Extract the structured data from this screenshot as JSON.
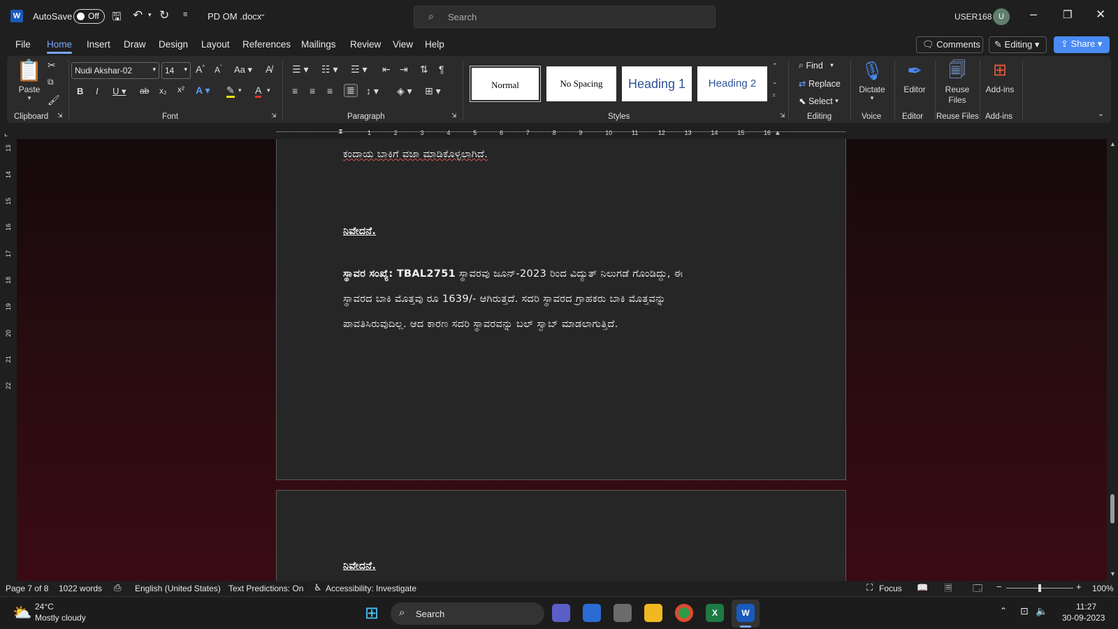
{
  "titlebar": {
    "app_icon": "W",
    "autosave_label": "AutoSave",
    "autosave_state": "Off",
    "doc_title": "PD OM .docx",
    "search_placeholder": "Search",
    "user": "USER168",
    "avatar_initial": "U"
  },
  "menu": {
    "tabs": [
      "File",
      "Home",
      "Insert",
      "Draw",
      "Design",
      "Layout",
      "References",
      "Mailings",
      "Review",
      "View",
      "Help"
    ],
    "active": "Home",
    "comments": "Comments",
    "editing": "Editing",
    "share": "Share"
  },
  "ribbon": {
    "clipboard": {
      "paste": "Paste",
      "label": "Clipboard"
    },
    "font": {
      "name": "Nudi Akshar-02",
      "size": "14",
      "label": "Font"
    },
    "paragraph": {
      "label": "Paragraph"
    },
    "styles": {
      "items": [
        "Normal",
        "No Spacing",
        "Heading 1",
        "Heading 2"
      ],
      "label": "Styles"
    },
    "editing": {
      "find": "Find",
      "replace": "Replace",
      "select": "Select",
      "label": "Editing"
    },
    "voice": {
      "dictate": "Dictate",
      "label": "Voice"
    },
    "editor": {
      "button": "Editor",
      "label": "Editor"
    },
    "reuse": {
      "button_line1": "Reuse",
      "button_line2": "Files",
      "label": "Reuse Files"
    },
    "addins": {
      "button": "Add-ins",
      "label": "Add-ins"
    }
  },
  "ruler": {
    "h_ticks": [
      "1",
      "2",
      "3",
      "4",
      "5",
      "6",
      "7",
      "8",
      "9",
      "10",
      "11",
      "12",
      "13",
      "14",
      "15",
      "16"
    ],
    "v_ticks": [
      "13",
      "14",
      "15",
      "16",
      "17",
      "18",
      "19",
      "20",
      "21",
      "22"
    ]
  },
  "document": {
    "line_top": "ಕಂದಾಯ ಬಾಕಿಗೆ ವಜಾ ಮಾಡಿಕೊಳ್ಳಲಾಗಿದೆ.",
    "heading1": "ನಿವೇದನೆ.",
    "para_label": "ಸ್ಥಾವರ ಸಂಖ್ಯೆ: TBAL2751",
    "para_line1": " ಸ್ಥಾವರವು ಜೂನ್-2023 ರಿಂದ ವಿದ್ಯುತ್ ನಿಲುಗಡೆ ಗೊಂಡಿದ್ದು, ಈ",
    "para_line2": "ಸ್ಥಾವರದ ಬಾಕಿ ಮೊತ್ತವು ರೂ 1639/- ಆಗಿರುತ್ತದೆ. ಸದರಿ ಸ್ಥಾವರದ ಗ್ರಾಹಕರು ಬಾಕಿ ಮೊತ್ತವನ್ನು",
    "para_line3": "ಪಾವತಿಸಿರುವುದಿಲ್ಲ. ಆದ ಕಾರಣ ಸದರಿ ಸ್ಥಾವರವನ್ನು ಬಲ್ ಸ್ವಾಬ್ ಮಾಡಲಾಗುತ್ತಿದೆ.",
    "heading2": "ನಿವೇದನೆ."
  },
  "status": {
    "page": "Page 7 of 8",
    "words": "1022 words",
    "language": "English (United States)",
    "predictions": "Text Predictions: On",
    "accessibility": "Accessibility: Investigate",
    "focus": "Focus",
    "zoom": "100%",
    "zoom_level": 0.5
  },
  "taskbar": {
    "weather_temp": "24°C",
    "weather_desc": "Mostly cloudy",
    "search": "Search",
    "time": "11:27",
    "date": "30-09-2023"
  }
}
